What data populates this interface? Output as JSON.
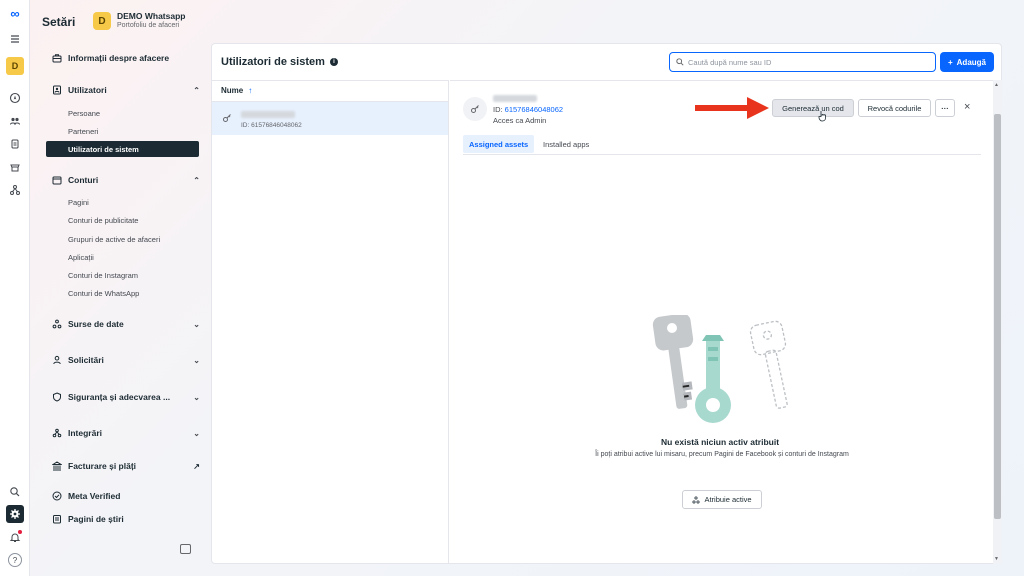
{
  "rail": {
    "logo": "∞",
    "business_initial": "D"
  },
  "header": {
    "title": "Setări",
    "business_initial": "D",
    "business_name": "DEMO Whatsapp",
    "business_sub": "Portofoliu de afaceri"
  },
  "nav": {
    "business_info": "Informații despre afacere",
    "users": {
      "label": "Utilizatori",
      "items": [
        "Persoane",
        "Parteneri",
        "Utilizatori de sistem"
      ]
    },
    "accounts": {
      "label": "Conturi",
      "items": [
        "Pagini",
        "Conturi de publicitate",
        "Grupuri de active de afaceri",
        "Aplicații",
        "Conturi de Instagram",
        "Conturi de WhatsApp"
      ]
    },
    "data_sources": "Surse de date",
    "requests": "Solicitări",
    "security": "Siguranța și adecvarea ...",
    "integrations": "Integrări",
    "billing": "Facturare și plăți",
    "meta_verified": "Meta Verified",
    "news": "Pagini de știri"
  },
  "main": {
    "title": "Utilizatori de sistem",
    "search_placeholder": "Caută după nume sau ID",
    "add_label": "Adaugă",
    "add_plus": "+",
    "list_header": "Nume",
    "list_sort": "↑",
    "row_id": "ID: 61576846048062"
  },
  "detail": {
    "id_label": "ID: ",
    "id_value": "61576846048062",
    "role": "Acces ca Admin",
    "generate": "Generează un cod",
    "revoke": "Revocă codurile",
    "more": "···",
    "close": "×",
    "tabs": [
      "Assigned assets",
      "Installed apps"
    ],
    "empty_title": "Nu există niciun activ atribuit",
    "empty_desc": "Îi poți atribui active lui misaru, precum Pagini de Facebook și conturi de Instagram",
    "assign_button": "Atribuie active"
  },
  "colors": {
    "accent": "#0866ff",
    "active_nav": "#1c2b33",
    "arrow": "#e8341c"
  }
}
